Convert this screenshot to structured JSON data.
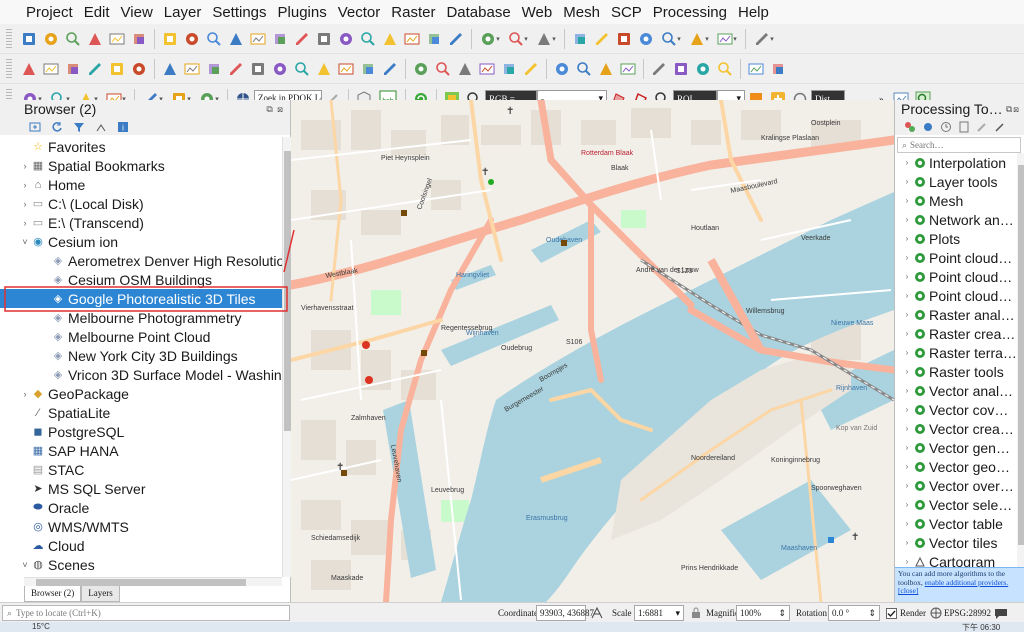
{
  "menubar": [
    "Project",
    "Edit",
    "View",
    "Layer",
    "Settings",
    "Plugins",
    "Vector",
    "Raster",
    "Database",
    "Web",
    "Mesh",
    "SCP",
    "Processing",
    "Help"
  ],
  "toolbar": {
    "locate_search_placeholder": "Zoek in PDOK Loc…",
    "hash_label": "hsh",
    "rgb_combo": "RGB =",
    "rgb_value": "-",
    "roi_label": "ROI",
    "dist_label": "Dist"
  },
  "browser": {
    "title": "Browser (2)",
    "items": [
      {
        "label": "Favorites",
        "icon": "star-icon",
        "arrow": "",
        "indent": 0
      },
      {
        "label": "Spatial Bookmarks",
        "icon": "bookmark-icon",
        "arrow": "›",
        "indent": 0
      },
      {
        "label": "Home",
        "icon": "home-folder-icon",
        "arrow": "›",
        "indent": 0
      },
      {
        "label": "C:\\ (Local Disk)",
        "icon": "folder-icon",
        "arrow": "›",
        "indent": 0
      },
      {
        "label": "E:\\ (Transcend)",
        "icon": "folder-icon",
        "arrow": "›",
        "indent": 0
      },
      {
        "label": "Cesium ion",
        "icon": "cesium-icon",
        "arrow": "˅",
        "indent": 0
      },
      {
        "label": "Aerometrex Denver High Resolution",
        "icon": "tileset-icon",
        "arrow": "",
        "indent": 1
      },
      {
        "label": "Cesium OSM Buildings",
        "icon": "tileset-icon",
        "arrow": "",
        "indent": 1
      },
      {
        "label": "Google Photorealistic 3D Tiles",
        "icon": "tileset-icon",
        "arrow": "",
        "indent": 1,
        "selected": true
      },
      {
        "label": "Melbourne Photogrammetry",
        "icon": "tileset-icon",
        "arrow": "",
        "indent": 1
      },
      {
        "label": "Melbourne Point Cloud",
        "icon": "tileset-icon",
        "arrow": "",
        "indent": 1
      },
      {
        "label": "New York City 3D Buildings",
        "icon": "tileset-icon",
        "arrow": "",
        "indent": 1
      },
      {
        "label": "Vricon 3D Surface Model - Washington",
        "icon": "tileset-icon",
        "arrow": "",
        "indent": 1
      },
      {
        "label": "GeoPackage",
        "icon": "geopackage-icon",
        "arrow": "›",
        "indent": 0
      },
      {
        "label": "SpatiaLite",
        "icon": "spatialite-icon",
        "arrow": "",
        "indent": 0
      },
      {
        "label": "PostgreSQL",
        "icon": "postgresql-icon",
        "arrow": "",
        "indent": 0
      },
      {
        "label": "SAP HANA",
        "icon": "hana-icon",
        "arrow": "",
        "indent": 0
      },
      {
        "label": "STAC",
        "icon": "stac-icon",
        "arrow": "",
        "indent": 0
      },
      {
        "label": "MS SQL Server",
        "icon": "mssql-icon",
        "arrow": "",
        "indent": 0
      },
      {
        "label": "Oracle",
        "icon": "oracle-icon",
        "arrow": "",
        "indent": 0
      },
      {
        "label": "WMS/WMTS",
        "icon": "wms-icon",
        "arrow": "",
        "indent": 0
      },
      {
        "label": "Cloud",
        "icon": "cloud-icon",
        "arrow": "",
        "indent": 0
      },
      {
        "label": "Scenes",
        "icon": "scenes-icon",
        "arrow": "˅",
        "indent": 0
      }
    ],
    "tabs": [
      "Browser (2)",
      "Layers"
    ],
    "locator_placeholder": "Type to locate (Ctrl+K)"
  },
  "map": {
    "labels": [
      "Westblaak",
      "Regentessebrug",
      "André van der Louw",
      "Willemsbrug",
      "S123",
      "S106",
      "Leuvehaven",
      "Leuvebrug",
      "Boompjes",
      "Maasboulevard",
      "Rotterdam Blaak",
      "Kop van Zuid",
      "Rijnhaven",
      "Erasmusbrug",
      "Wijnhaven",
      "Oudehaven",
      "Haringvliet",
      "Noordereiland",
      "Koninginnebrug",
      "Maashaven",
      "Nieuwe Maas",
      "Oostplein",
      "Zalmhaven",
      "Coolsingel",
      "Schiedamsedijk",
      "Blaak",
      "Oudebrug",
      "Kralingse Plaslaan",
      "Spoorweghaven",
      "Maaskade",
      "Prins Hendrikkade",
      "Burgemeester",
      "Vierhavensstraat",
      "Veerkade",
      "Houtlaan",
      "Piet Heynsplein"
    ]
  },
  "processing": {
    "title": "Processing To…",
    "search_placeholder": "Search…",
    "items": [
      {
        "label": "Interpolation",
        "icon": "algorithm-group-icon"
      },
      {
        "label": "Layer tools",
        "icon": "algorithm-group-icon"
      },
      {
        "label": "Mesh",
        "icon": "algorithm-group-icon"
      },
      {
        "label": "Network an…",
        "icon": "algorithm-group-icon"
      },
      {
        "label": "Plots",
        "icon": "algorithm-group-icon"
      },
      {
        "label": "Point cloud…",
        "icon": "algorithm-group-icon"
      },
      {
        "label": "Point cloud…",
        "icon": "algorithm-group-icon"
      },
      {
        "label": "Point cloud…",
        "icon": "algorithm-group-icon"
      },
      {
        "label": "Raster anal…",
        "icon": "algorithm-group-icon"
      },
      {
        "label": "Raster crea…",
        "icon": "algorithm-group-icon"
      },
      {
        "label": "Raster terra…",
        "icon": "algorithm-group-icon"
      },
      {
        "label": "Raster tools",
        "icon": "algorithm-group-icon"
      },
      {
        "label": "Vector anal…",
        "icon": "algorithm-group-icon"
      },
      {
        "label": "Vector cov…",
        "icon": "algorithm-group-icon"
      },
      {
        "label": "Vector crea…",
        "icon": "algorithm-group-icon"
      },
      {
        "label": "Vector gen…",
        "icon": "algorithm-group-icon"
      },
      {
        "label": "Vector geo…",
        "icon": "algorithm-group-icon"
      },
      {
        "label": "Vector over…",
        "icon": "algorithm-group-icon"
      },
      {
        "label": "Vector sele…",
        "icon": "algorithm-group-icon"
      },
      {
        "label": "Vector table",
        "icon": "algorithm-group-icon"
      },
      {
        "label": "Vector tiles",
        "icon": "algorithm-group-icon"
      },
      {
        "label": "Cartogram",
        "icon": "cartogram-plugin-icon"
      }
    ],
    "note_text": "You can add more algorithms to the toolbox,",
    "note_link": "enable additional providers.",
    "note_close": "[close]"
  },
  "statusbar": {
    "coordinate_label": "Coordinate",
    "coordinate_value": "93903, 436887",
    "scale_label": "Scale",
    "scale_value": "1:6881",
    "magnifier_label": "Magnifier",
    "magnifier_value": "100%",
    "rotation_label": "Rotation",
    "rotation_value": "0.0 °",
    "render_label": "Render",
    "crs_label": "EPSG:28992"
  },
  "taskbar": {
    "temperature": "15°C",
    "time": "下午 06:30"
  },
  "colors": {
    "selection": "#2d86d3",
    "annotation_red": "#e03030",
    "water": "#aad3df",
    "road_major": "#f9b29c",
    "road_secondary": "#fcd6a4",
    "land": "#f2efe9",
    "processing_note": "#c6e2ff"
  }
}
